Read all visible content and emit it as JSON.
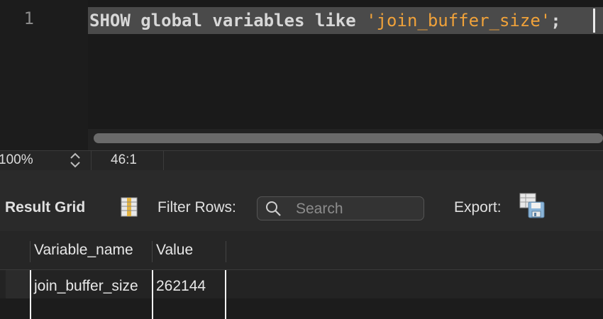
{
  "editor": {
    "line_number": "1",
    "code_keyword": "SHOW global variables like ",
    "code_string": "'join_buffer_size'",
    "code_terminator": ";"
  },
  "status": {
    "zoom": "100%",
    "cursor_position": "46:1"
  },
  "toolbar": {
    "result_grid_label": "Result Grid",
    "filter_label": "Filter Rows:",
    "search_placeholder": "Search",
    "export_label": "Export:"
  },
  "table": {
    "columns": [
      "Variable_name",
      "Value"
    ],
    "rows": [
      [
        "join_buffer_size",
        "262144"
      ]
    ]
  },
  "colors": {
    "string_literal": "#f0a23a",
    "highlight_line": "#4a4a4a"
  }
}
